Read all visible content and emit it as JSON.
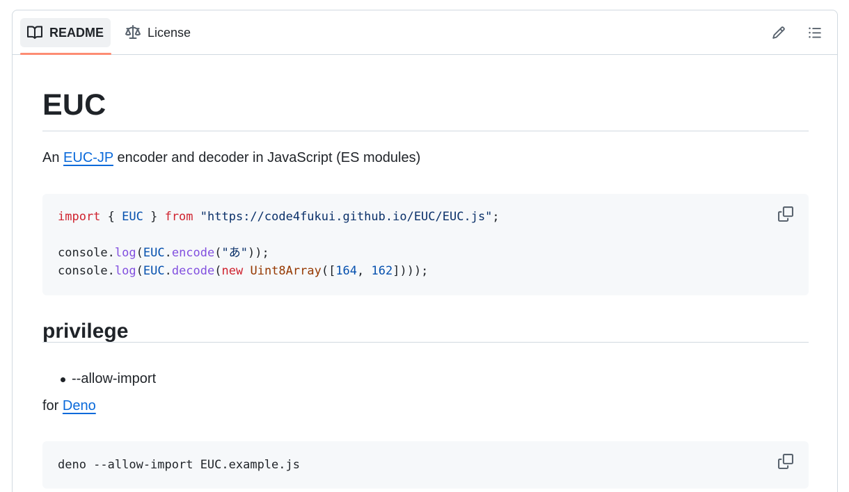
{
  "tabs": {
    "readme_label": "README",
    "license_label": "License"
  },
  "toolbar": {
    "edit_icon": "pencil-icon",
    "outline_icon": "list-unordered-icon"
  },
  "readme": {
    "title": "EUC",
    "description": {
      "prefix": "An ",
      "link_text": "EUC-JP",
      "suffix": " encoder and decoder in JavaScript (ES modules)"
    },
    "code1": {
      "line1": {
        "kw_import": "import",
        "brace_open": " { ",
        "ident": "EUC",
        "brace_close": " } ",
        "kw_from": "from",
        "space": " ",
        "string": "\"https://code4fukui.github.io/EUC/EUC.js\"",
        "semi": ";"
      },
      "line2": {
        "obj": "console.",
        "fn_log": "log",
        "paren1": "(",
        "ident": "EUC",
        "dot": ".",
        "fn_encode": "encode",
        "paren2": "(",
        "string": "\"あ\"",
        "end": "));"
      },
      "line3": {
        "obj": "console.",
        "fn_log": "log",
        "paren1": "(",
        "ident": "EUC",
        "dot": ".",
        "fn_decode": "decode",
        "paren2": "(",
        "kw_new": "new",
        "space": " ",
        "cls": "Uint8Array",
        "bracket": "([",
        "num1": "164",
        "comma": ", ",
        "num2": "162",
        "end": "])));"
      }
    },
    "section_heading": "privilege",
    "bullets": [
      "--allow-import"
    ],
    "for_line": {
      "prefix": "for ",
      "link_text": "Deno"
    },
    "code2": {
      "line1": "deno --allow-import EUC.example.js"
    },
    "copy_icon": "copy-icon"
  }
}
